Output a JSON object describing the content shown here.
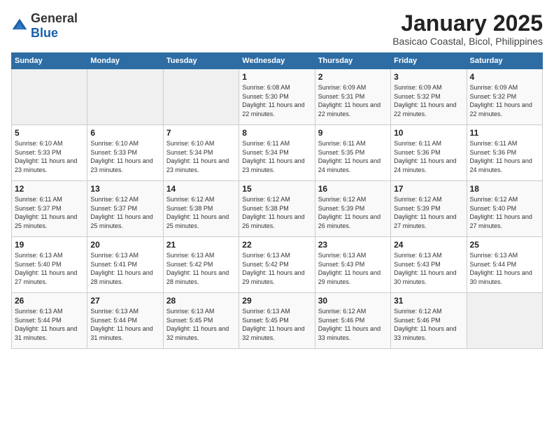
{
  "logo": {
    "general": "General",
    "blue": "Blue"
  },
  "title": "January 2025",
  "subtitle": "Basicao Coastal, Bicol, Philippines",
  "weekdays": [
    "Sunday",
    "Monday",
    "Tuesday",
    "Wednesday",
    "Thursday",
    "Friday",
    "Saturday"
  ],
  "weeks": [
    [
      {
        "day": "",
        "info": ""
      },
      {
        "day": "",
        "info": ""
      },
      {
        "day": "",
        "info": ""
      },
      {
        "day": "1",
        "info": "Sunrise: 6:08 AM\nSunset: 5:30 PM\nDaylight: 11 hours and 22 minutes."
      },
      {
        "day": "2",
        "info": "Sunrise: 6:09 AM\nSunset: 5:31 PM\nDaylight: 11 hours and 22 minutes."
      },
      {
        "day": "3",
        "info": "Sunrise: 6:09 AM\nSunset: 5:32 PM\nDaylight: 11 hours and 22 minutes."
      },
      {
        "day": "4",
        "info": "Sunrise: 6:09 AM\nSunset: 5:32 PM\nDaylight: 11 hours and 22 minutes."
      }
    ],
    [
      {
        "day": "5",
        "info": "Sunrise: 6:10 AM\nSunset: 5:33 PM\nDaylight: 11 hours and 23 minutes."
      },
      {
        "day": "6",
        "info": "Sunrise: 6:10 AM\nSunset: 5:33 PM\nDaylight: 11 hours and 23 minutes."
      },
      {
        "day": "7",
        "info": "Sunrise: 6:10 AM\nSunset: 5:34 PM\nDaylight: 11 hours and 23 minutes."
      },
      {
        "day": "8",
        "info": "Sunrise: 6:11 AM\nSunset: 5:34 PM\nDaylight: 11 hours and 23 minutes."
      },
      {
        "day": "9",
        "info": "Sunrise: 6:11 AM\nSunset: 5:35 PM\nDaylight: 11 hours and 24 minutes."
      },
      {
        "day": "10",
        "info": "Sunrise: 6:11 AM\nSunset: 5:36 PM\nDaylight: 11 hours and 24 minutes."
      },
      {
        "day": "11",
        "info": "Sunrise: 6:11 AM\nSunset: 5:36 PM\nDaylight: 11 hours and 24 minutes."
      }
    ],
    [
      {
        "day": "12",
        "info": "Sunrise: 6:11 AM\nSunset: 5:37 PM\nDaylight: 11 hours and 25 minutes."
      },
      {
        "day": "13",
        "info": "Sunrise: 6:12 AM\nSunset: 5:37 PM\nDaylight: 11 hours and 25 minutes."
      },
      {
        "day": "14",
        "info": "Sunrise: 6:12 AM\nSunset: 5:38 PM\nDaylight: 11 hours and 25 minutes."
      },
      {
        "day": "15",
        "info": "Sunrise: 6:12 AM\nSunset: 5:38 PM\nDaylight: 11 hours and 26 minutes."
      },
      {
        "day": "16",
        "info": "Sunrise: 6:12 AM\nSunset: 5:39 PM\nDaylight: 11 hours and 26 minutes."
      },
      {
        "day": "17",
        "info": "Sunrise: 6:12 AM\nSunset: 5:39 PM\nDaylight: 11 hours and 27 minutes."
      },
      {
        "day": "18",
        "info": "Sunrise: 6:12 AM\nSunset: 5:40 PM\nDaylight: 11 hours and 27 minutes."
      }
    ],
    [
      {
        "day": "19",
        "info": "Sunrise: 6:13 AM\nSunset: 5:40 PM\nDaylight: 11 hours and 27 minutes."
      },
      {
        "day": "20",
        "info": "Sunrise: 6:13 AM\nSunset: 5:41 PM\nDaylight: 11 hours and 28 minutes."
      },
      {
        "day": "21",
        "info": "Sunrise: 6:13 AM\nSunset: 5:42 PM\nDaylight: 11 hours and 28 minutes."
      },
      {
        "day": "22",
        "info": "Sunrise: 6:13 AM\nSunset: 5:42 PM\nDaylight: 11 hours and 29 minutes."
      },
      {
        "day": "23",
        "info": "Sunrise: 6:13 AM\nSunset: 5:43 PM\nDaylight: 11 hours and 29 minutes."
      },
      {
        "day": "24",
        "info": "Sunrise: 6:13 AM\nSunset: 5:43 PM\nDaylight: 11 hours and 30 minutes."
      },
      {
        "day": "25",
        "info": "Sunrise: 6:13 AM\nSunset: 5:44 PM\nDaylight: 11 hours and 30 minutes."
      }
    ],
    [
      {
        "day": "26",
        "info": "Sunrise: 6:13 AM\nSunset: 5:44 PM\nDaylight: 11 hours and 31 minutes."
      },
      {
        "day": "27",
        "info": "Sunrise: 6:13 AM\nSunset: 5:44 PM\nDaylight: 11 hours and 31 minutes."
      },
      {
        "day": "28",
        "info": "Sunrise: 6:13 AM\nSunset: 5:45 PM\nDaylight: 11 hours and 32 minutes."
      },
      {
        "day": "29",
        "info": "Sunrise: 6:13 AM\nSunset: 5:45 PM\nDaylight: 11 hours and 32 minutes."
      },
      {
        "day": "30",
        "info": "Sunrise: 6:12 AM\nSunset: 5:46 PM\nDaylight: 11 hours and 33 minutes."
      },
      {
        "day": "31",
        "info": "Sunrise: 6:12 AM\nSunset: 5:46 PM\nDaylight: 11 hours and 33 minutes."
      },
      {
        "day": "",
        "info": ""
      }
    ]
  ]
}
